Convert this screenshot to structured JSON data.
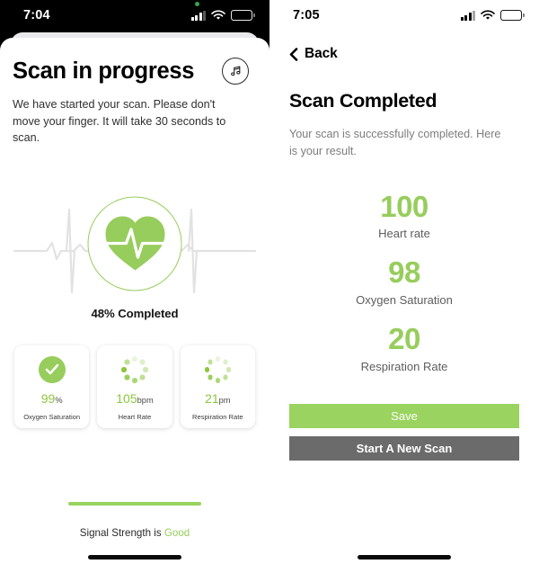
{
  "screens": {
    "left": {
      "status_bar": {
        "time": "7:04",
        "recording_dot": true,
        "wifi_icon": "wifi-icon",
        "battery_icon": "battery-icon",
        "signal_icon": "cellular-bars-icon"
      },
      "title": "Scan in progress",
      "music_icon": "music-note-icon",
      "description": "We have started your scan. Please don't move your finger. It will take 30 seconds to scan.",
      "heart_icon": "heart-pulse-icon",
      "ecg_icon": "ecg-waveform-icon",
      "progress_text": "48% Completed",
      "progress_percent": 48,
      "cards": [
        {
          "icon": "check-circle-icon",
          "value": "99",
          "unit": "%",
          "label": "Oxygen Saturation",
          "state": "complete"
        },
        {
          "icon": "loading-spinner-icon",
          "value": "105",
          "unit": "bpm",
          "label": "Heart Rate",
          "state": "loading"
        },
        {
          "icon": "loading-spinner-icon",
          "value": "21",
          "unit": "pm",
          "label": "Respiration Rate",
          "state": "loading"
        }
      ],
      "signal_strength_prefix": "Signal Strength is ",
      "signal_strength_value": "Good"
    },
    "right": {
      "status_bar": {
        "time": "7:05",
        "wifi_icon": "wifi-icon",
        "battery_icon": "battery-icon",
        "signal_icon": "cellular-bars-icon"
      },
      "back_icon": "chevron-left-icon",
      "back_label": "Back",
      "title": "Scan Completed",
      "description": "Your scan is successfully completed. Here is your result.",
      "results": [
        {
          "value": "100",
          "label": "Heart rate"
        },
        {
          "value": "98",
          "label": "Oxygen Saturation"
        },
        {
          "value": "20",
          "label": "Respiration Rate"
        }
      ],
      "buttons": [
        {
          "label": "Save",
          "style": "primary"
        },
        {
          "label": "Start A New Scan",
          "style": "secondary"
        }
      ]
    }
  },
  "colors": {
    "accent_green": "#97cd5c",
    "progress_green": "#97d45f",
    "button_gray": "#6b6b6b",
    "muted_text": "#7d7d7d"
  }
}
